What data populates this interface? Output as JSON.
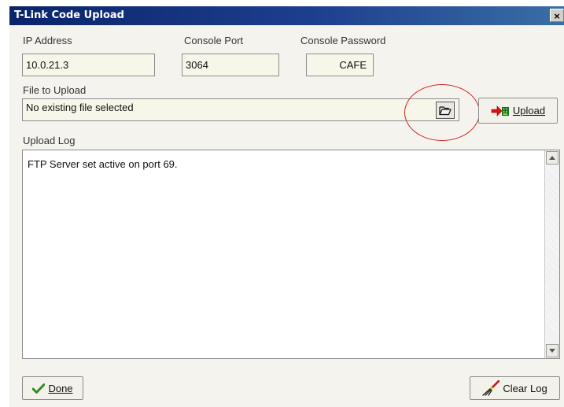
{
  "window": {
    "title": "T-Link Code Upload",
    "close_glyph": "×"
  },
  "ip": {
    "label": "IP Address",
    "value": "10.0.21.3"
  },
  "port": {
    "label": "Console Port",
    "value": "3064"
  },
  "password": {
    "label": "Console Password",
    "value": "CAFE"
  },
  "file": {
    "label": "File to Upload",
    "value": "No existing file selected"
  },
  "upload_button": {
    "label": "Upload"
  },
  "log": {
    "label": "Upload Log",
    "text": "FTP Server set active on port 69."
  },
  "done_button": {
    "label": "Done"
  },
  "clear_button": {
    "label": "Clear Log"
  },
  "colors": {
    "titlebar": "#0a246a",
    "annotation_circle": "#d62020",
    "done_check": "#2a8a1a"
  },
  "icons": {
    "browse": "folder-open-icon",
    "upload": "upload-arrow-icon",
    "done": "checkmark-icon",
    "clear": "broom-icon",
    "scroll_up": "arrow-up-icon",
    "scroll_down": "arrow-down-icon"
  }
}
